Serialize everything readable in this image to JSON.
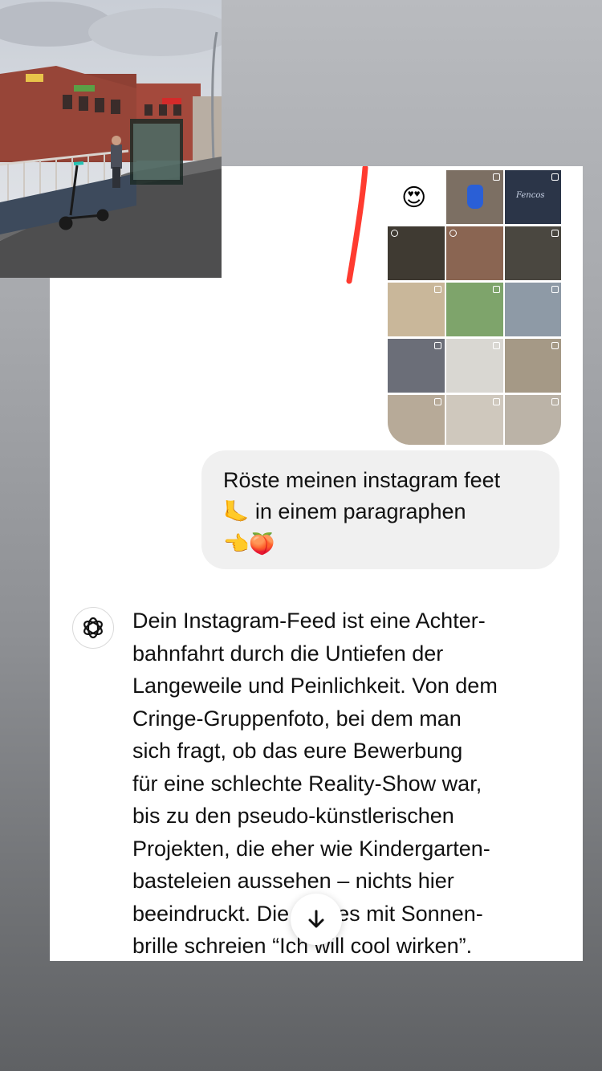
{
  "chat": {
    "reaction_emoji": "😍",
    "user_message": {
      "line1": "Röste meinen instagram feet",
      "emoji_foot": "🦶",
      "line2": "in einem paragraphen",
      "emoji_end": "👈🍑"
    },
    "assistant_message": "Dein Instagram-Feed ist eine Achter-\nbahnfahrt durch die Untiefen der\nLangeweile und Peinlichkeit. Von dem\nCringe-Gruppenfoto, bei dem man\nsich fragt, ob das eure Bewerbung\nfür eine schlechte Reality-Show war,\nbis zu den pseudo-künstlerischen\nProjekten, die eher wie Kindergarten-\nbasteleien aussehen – nichts hier\nbeeindruckt. Die Selfies mit Sonnen-\nbrille schreien “Ich will cool wirken”."
  },
  "photo_grid": {
    "tiles": [
      {
        "name": "tile-emoji-slot",
        "color": "#ffffff"
      },
      {
        "name": "tile-blue-lock",
        "color": "#7c6f63"
      },
      {
        "name": "tile-sign",
        "color": "#2b3548",
        "text": "Fencos"
      },
      {
        "name": "tile-group-photo",
        "color": "#3f3a32"
      },
      {
        "name": "tile-party-photo",
        "color": "#8a6552"
      },
      {
        "name": "tile-pavement",
        "color": "#4a4740"
      },
      {
        "name": "tile-selfie-sunglasses",
        "color": "#c9b79a"
      },
      {
        "name": "tile-green-net",
        "color": "#7ea46b"
      },
      {
        "name": "tile-street-balloons",
        "color": "#8e9aa6"
      },
      {
        "name": "tile-suit-mirror",
        "color": "#6b6e78"
      },
      {
        "name": "tile-sketch",
        "color": "#d9d7d2"
      },
      {
        "name": "tile-selfie-2",
        "color": "#a59986"
      },
      {
        "name": "tile-hallway",
        "color": "#b7aa98"
      },
      {
        "name": "tile-room-door",
        "color": "#cfc8bd"
      },
      {
        "name": "tile-wide-room",
        "color": "#bbb3a7"
      },
      {
        "name": "tile-craft-blue",
        "color": "#c7b8c6"
      },
      {
        "name": "tile-garden-book",
        "color": "#8b8a4e"
      },
      {
        "name": "tile-street-market",
        "color": "#9aa0a8"
      }
    ]
  },
  "colors": {
    "accent_red": "#ff3b30",
    "bubble": "#f0f0f0"
  },
  "icons": {
    "assistant": "chatgpt-logo-icon",
    "scroll": "arrow-down-icon"
  }
}
